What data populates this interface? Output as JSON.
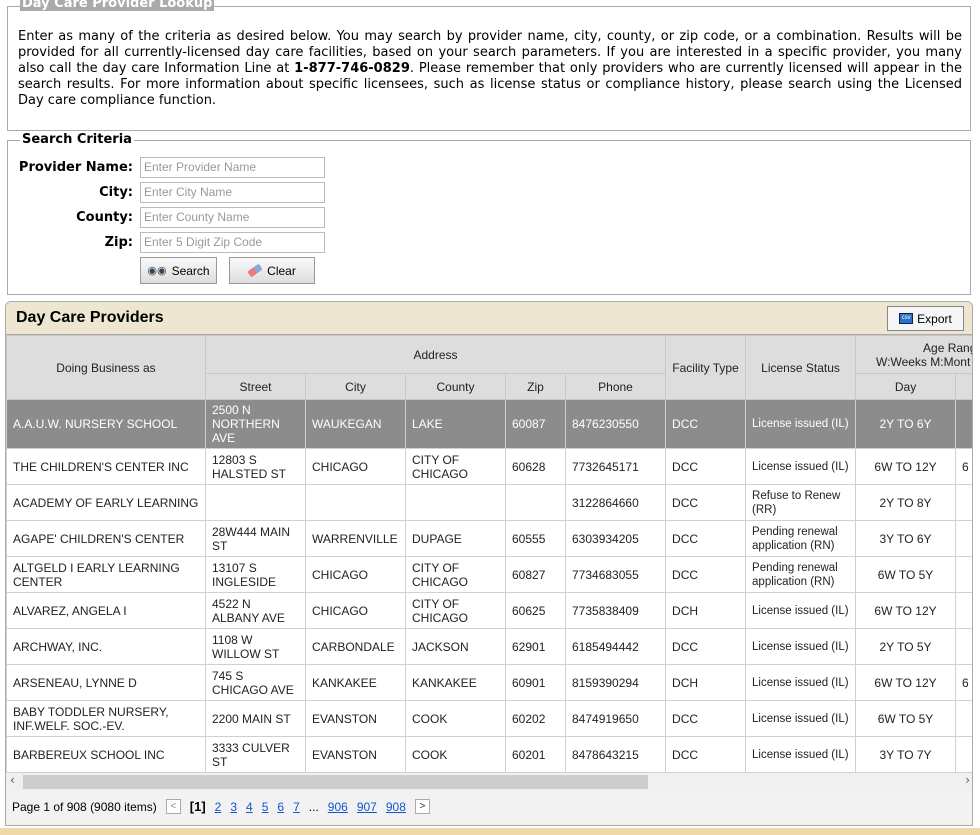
{
  "lookup": {
    "title": "Day Care Provider Lookup",
    "intro_before": "Enter as many of the criteria as desired below. You may search by provider name, city, county, or zip code, or a combination. Results will be provided for all currently-licensed day care facilities, based on your search parameters. If you are interested in a specific provider, you many also call the day care Information Line at ",
    "phone": "1-877-746-0829",
    "intro_after": ". Please remember that only providers who are currently licensed will appear in the search results. For more information about specific licensees, such as license status or compliance history, please search using the Licensed Day care compliance function."
  },
  "criteria": {
    "title": "Search Criteria",
    "fields": [
      {
        "label": "Provider Name:",
        "placeholder": "Enter Provider Name",
        "value": ""
      },
      {
        "label": "City:",
        "placeholder": "Enter City Name",
        "value": ""
      },
      {
        "label": "County:",
        "placeholder": "Enter County Name",
        "value": ""
      },
      {
        "label": "Zip:",
        "placeholder": "Enter 5 Digit Zip Code",
        "value": ""
      }
    ],
    "search_label": "Search",
    "clear_label": "Clear"
  },
  "grid": {
    "title": "Day Care Providers",
    "export_label": "Export",
    "export_icon": "csv",
    "headers": {
      "dba": "Doing Business as",
      "address": "Address",
      "street": "Street",
      "city": "City",
      "county": "County",
      "zip": "Zip",
      "phone": "Phone",
      "facility": "Facility Type",
      "license": "License Status",
      "age": "Age Rang",
      "age_sub": "W:Weeks M:Mont",
      "day": "Day"
    },
    "rows": [
      {
        "dba": "A.A.U.W. NURSERY SCHOOL",
        "street": "2500 N NORTHERN AVE",
        "city": "WAUKEGAN",
        "county": "LAKE",
        "zip": "60087",
        "phone": "8476230550",
        "facility": "DCC",
        "license": "License issued (IL)",
        "day": "2Y TO 6Y",
        "next": "",
        "selected": true
      },
      {
        "dba": "THE CHILDREN'S CENTER INC",
        "street": "12803 S HALSTED ST",
        "city": "CHICAGO",
        "county": "CITY OF CHICAGO",
        "zip": "60628",
        "phone": "7732645171",
        "facility": "DCC",
        "license": "License issued (IL)",
        "day": "6W TO 12Y",
        "next": "6"
      },
      {
        "dba": "ACADEMY OF EARLY LEARNING",
        "street": "",
        "city": "",
        "county": "",
        "zip": "",
        "phone": "3122864660",
        "facility": "DCC",
        "license": "Refuse to Renew (RR)",
        "day": "2Y TO 8Y",
        "next": ""
      },
      {
        "dba": "AGAPE' CHILDREN'S CENTER",
        "street": "28W444 MAIN ST",
        "city": "WARRENVILLE",
        "county": "DUPAGE",
        "zip": "60555",
        "phone": "6303934205",
        "facility": "DCC",
        "license": "Pending renewal application (RN)",
        "day": "3Y TO 6Y",
        "next": ""
      },
      {
        "dba": "ALTGELD I EARLY LEARNING CENTER",
        "street": "13107 S INGLESIDE",
        "city": "CHICAGO",
        "county": "CITY OF CHICAGO",
        "zip": "60827",
        "phone": "7734683055",
        "facility": "DCC",
        "license": "Pending renewal application (RN)",
        "day": "6W TO 5Y",
        "next": ""
      },
      {
        "dba": "ALVAREZ, ANGELA I",
        "street": "4522 N ALBANY AVE",
        "city": "CHICAGO",
        "county": "CITY OF CHICAGO",
        "zip": "60625",
        "phone": "7735838409",
        "facility": "DCH",
        "license": "License issued (IL)",
        "day": "6W TO 12Y",
        "next": ""
      },
      {
        "dba": "ARCHWAY, INC.",
        "street": "1108 W WILLOW ST",
        "city": "CARBONDALE",
        "county": "JACKSON",
        "zip": "62901",
        "phone": "6185494442",
        "facility": "DCC",
        "license": "License issued (IL)",
        "day": "2Y TO 5Y",
        "next": ""
      },
      {
        "dba": "ARSENEAU, LYNNE D",
        "street": "745 S CHICAGO AVE",
        "city": "KANKAKEE",
        "county": "KANKAKEE",
        "zip": "60901",
        "phone": "8159390294",
        "facility": "DCH",
        "license": "License issued (IL)",
        "day": "6W TO 12Y",
        "next": "6"
      },
      {
        "dba": "BABY TODDLER NURSERY, INF.WELF. SOC.-EV.",
        "street": "2200 MAIN ST",
        "city": "EVANSTON",
        "county": "COOK",
        "zip": "60202",
        "phone": "8474919650",
        "facility": "DCC",
        "license": "License issued (IL)",
        "day": "6W TO 5Y",
        "next": ""
      },
      {
        "dba": "BARBEREUX SCHOOL INC",
        "street": "3333 CULVER ST",
        "city": "EVANSTON",
        "county": "COOK",
        "zip": "60201",
        "phone": "8478643215",
        "facility": "DCC",
        "license": "License issued (IL)",
        "day": "3Y TO 7Y",
        "next": ""
      }
    ]
  },
  "pager": {
    "summary": "Page 1 of 908 (9080 items)",
    "current": "[1]",
    "pages": [
      "2",
      "3",
      "4",
      "5",
      "6",
      "7"
    ],
    "ellipsis": "...",
    "last_pages": [
      "906",
      "907",
      "908"
    ]
  }
}
